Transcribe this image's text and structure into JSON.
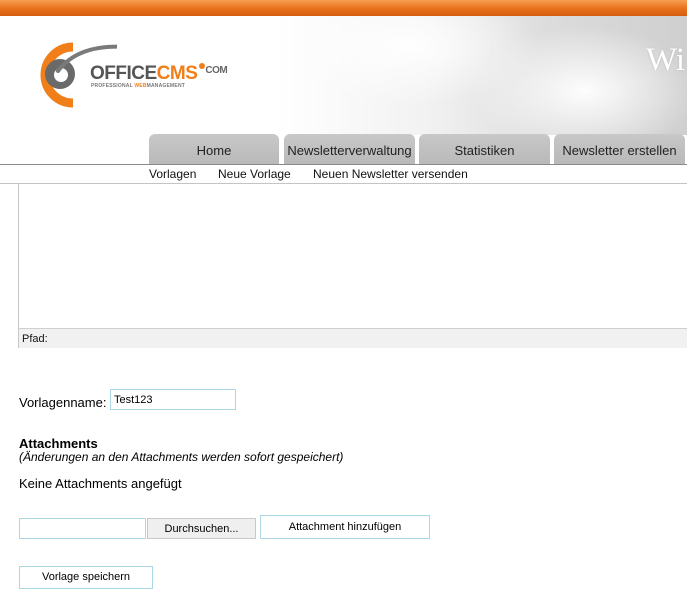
{
  "header": {
    "title_fragment": "Wi",
    "brand": {
      "office": "OFFICE",
      "cms": "CMS",
      "com": "COM",
      "tagline_pre": "PROFESSIONAL ",
      "tagline_hl": "WEB",
      "tagline_post": "MANAGEMENT"
    }
  },
  "tabs": [
    {
      "label": "Home"
    },
    {
      "label": "Newsletterverwaltung"
    },
    {
      "label": "Statistiken"
    },
    {
      "label": "Newsletter erstellen"
    }
  ],
  "subnav": [
    {
      "label": "Vorlagen"
    },
    {
      "label": "Neue Vorlage"
    },
    {
      "label": "Neuen Newsletter versenden"
    }
  ],
  "editor": {
    "path_label": "Pfad:"
  },
  "form": {
    "template_name_label": "Vorlagenname:",
    "template_name_value": "Test123",
    "attachments_heading": "Attachments",
    "attachments_note": "(Änderungen an den Attachments werden sofort gespeichert)",
    "attachments_empty": "Keine Attachments angefügt",
    "browse_button": "Durchsuchen...",
    "add_attachment_button": "Attachment hinzufügen",
    "save_button": "Vorlage speichern"
  },
  "colors": {
    "accent_orange": "#f07f1a",
    "tab_gray": "#c0c0c0",
    "input_border": "#a9d7e6"
  }
}
